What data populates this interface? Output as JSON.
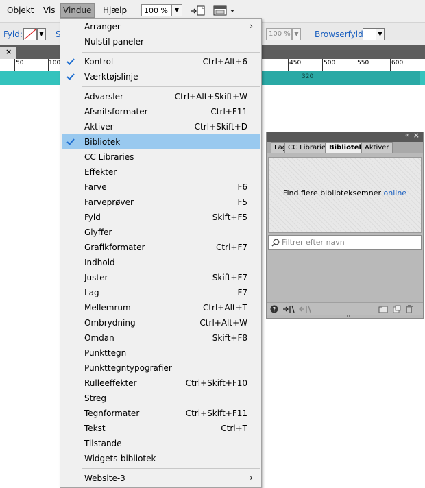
{
  "menubar": {
    "items": [
      "Objekt",
      "Vis",
      "Vindue",
      "Hjælp"
    ],
    "zoom_value": "100 %"
  },
  "controlbar": {
    "fill_label": "Fyld:",
    "stroke_label_partial": "S",
    "opacity_value": "100 %",
    "browser_fill_label": "Browserfyld:"
  },
  "ruler": {
    "labels": [
      "50",
      "100",
      "450",
      "500",
      "550",
      "600"
    ],
    "teal_label": "320"
  },
  "menu": {
    "top_items": [
      {
        "label": "Arranger",
        "submenu": true
      },
      {
        "label": "Nulstil paneler"
      }
    ],
    "checked_items": [
      {
        "label": "Kontrol",
        "shortcut": "Ctrl+Alt+6",
        "checked": true
      },
      {
        "label": "Værktøjslinje",
        "checked": true
      }
    ],
    "panel_items": [
      {
        "label": "Advarsler",
        "shortcut": "Ctrl+Alt+Skift+W"
      },
      {
        "label": "Afsnitsformater",
        "shortcut": "Ctrl+F11"
      },
      {
        "label": "Aktiver",
        "shortcut": "Ctrl+Skift+D"
      },
      {
        "label": "Bibliotek",
        "shortcut": "",
        "checked": true,
        "highlighted": true
      },
      {
        "label": "CC Libraries",
        "shortcut": ""
      },
      {
        "label": "Effekter",
        "shortcut": ""
      },
      {
        "label": "Farve",
        "shortcut": "F6"
      },
      {
        "label": "Farveprøver",
        "shortcut": "F5"
      },
      {
        "label": "Fyld",
        "shortcut": "Skift+F5"
      },
      {
        "label": "Glyffer",
        "shortcut": ""
      },
      {
        "label": "Grafikformater",
        "shortcut": "Ctrl+F7"
      },
      {
        "label": "Indhold",
        "shortcut": ""
      },
      {
        "label": "Juster",
        "shortcut": "Skift+F7"
      },
      {
        "label": "Lag",
        "shortcut": "F7"
      },
      {
        "label": "Mellemrum",
        "shortcut": "Ctrl+Alt+T"
      },
      {
        "label": "Ombrydning",
        "shortcut": "Ctrl+Alt+W"
      },
      {
        "label": "Omdan",
        "shortcut": "Skift+F8"
      },
      {
        "label": "Punkttegn",
        "shortcut": ""
      },
      {
        "label": "Punkttegntypografier",
        "shortcut": ""
      },
      {
        "label": "Rulleeffekter",
        "shortcut": "Ctrl+Skift+F10"
      },
      {
        "label": "Streg",
        "shortcut": ""
      },
      {
        "label": "Tegnformater",
        "shortcut": "Ctrl+Skift+F11"
      },
      {
        "label": "Tekst",
        "shortcut": "Ctrl+T"
      },
      {
        "label": "Tilstande",
        "shortcut": ""
      },
      {
        "label": "Widgets-bibliotek",
        "shortcut": ""
      }
    ],
    "bottom_items": [
      {
        "label": "Website-3",
        "submenu": true
      }
    ]
  },
  "library_panel": {
    "tabs": [
      "Lag",
      "CC Libraries",
      "Bibliotek",
      "Aktiver"
    ],
    "active_tab": "Bibliotek",
    "message": "Find flere biblioteksemner",
    "message_link": "online",
    "search_placeholder": "Filtrer efter navn"
  },
  "colors": {
    "menu_highlight": "#99c9ef",
    "check_blue": "#1f6fd1",
    "link_blue": "#1a5fbf",
    "teal": "#34c3bd"
  }
}
